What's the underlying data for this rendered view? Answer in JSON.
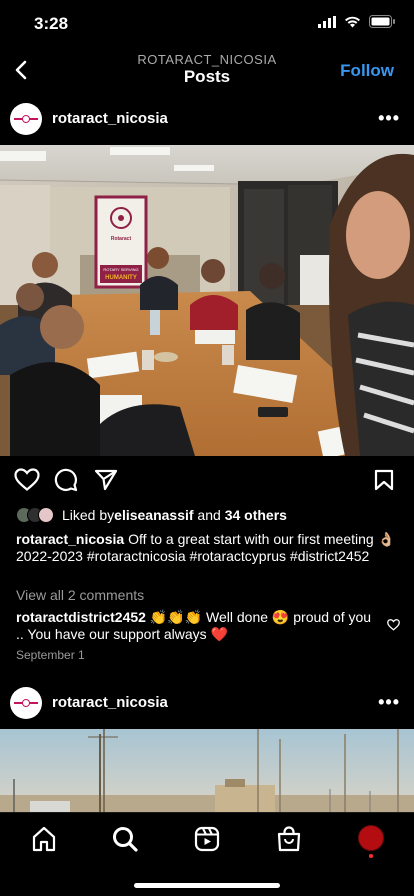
{
  "status_bar": {
    "time": "3:28"
  },
  "nav": {
    "subtitle": "ROTARACT_NICOSIA",
    "title": "Posts",
    "follow_label": "Follow"
  },
  "post1": {
    "username": "rotaract_nicosia",
    "photo_banner": {
      "line1": "Rotaract",
      "line2": "ROTARY SERVING",
      "line3": "HUMANITY"
    },
    "likes": {
      "prefix": "Liked by ",
      "user": "eliseanassif",
      "middle": " and ",
      "others": "34 others"
    },
    "caption": {
      "user": "rotaract_nicosia",
      "text": "Off to a great start with our first meeting 👌🏼 2022-2023 #rotaractnicosia #rotaractcyprus #district2452"
    },
    "view_comments": "View all 2 comments",
    "comment": {
      "user": "rotaractdistrict2452",
      "text": "👏👏👏 Well done 😍 proud of you .. You have our support always ❤️"
    },
    "date": "September 1"
  },
  "post2": {
    "username": "rotaract_nicosia"
  },
  "icons": {
    "back": "chevron-left-icon",
    "more": "more-icon",
    "like": "heart-icon",
    "comment": "comment-icon",
    "share": "send-icon",
    "save": "bookmark-icon",
    "home": "home-icon",
    "search": "search-icon",
    "reels": "reels-icon",
    "shop": "shop-icon"
  },
  "colors": {
    "background": "#000000",
    "follow": "#3897f0",
    "muted": "#9a9a9a",
    "comment_heart": "#ff2d2d"
  }
}
